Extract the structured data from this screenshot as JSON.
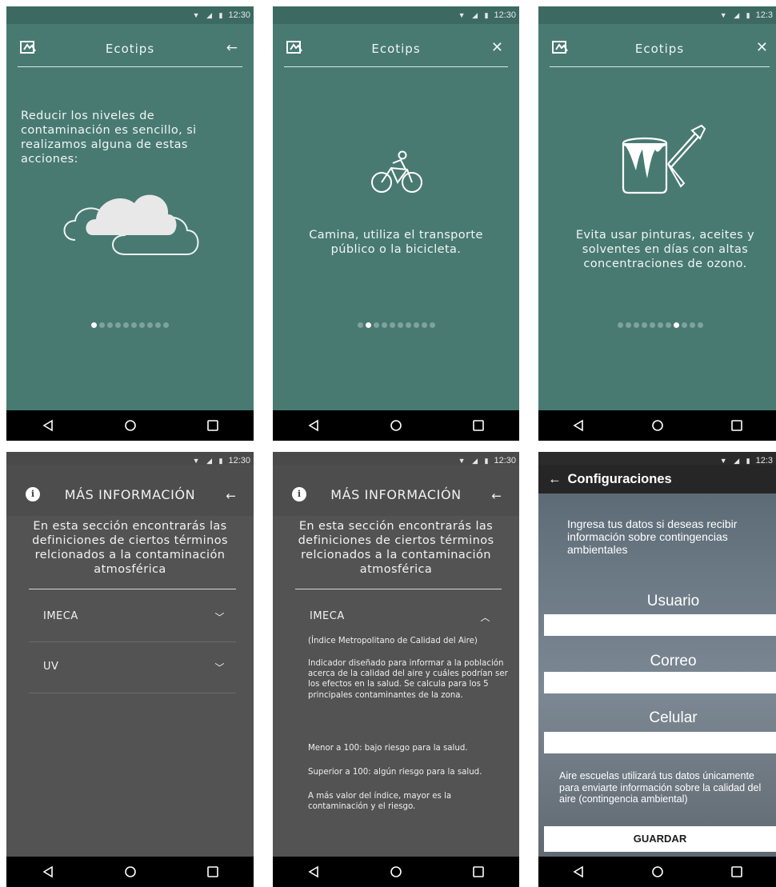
{
  "status": {
    "time": "12:30",
    "time_clipped": "12:3"
  },
  "ecotips": {
    "title": "Ecotips",
    "back_icon": "arrow-left-icon",
    "close_icon": "close-icon",
    "screen1_text": "Reducir los niveles de contaminación es sencillo, si realizamos alguna de estas acciones:",
    "screen2_text": "Camina, utiliza el transporte público o la bicicleta.",
    "screen3_text": "Evita usar pinturas, aceites y solventes en días con altas concentraciones de ozono.",
    "dots_total": 10,
    "active_dot": [
      1,
      2,
      8
    ]
  },
  "info": {
    "title": "MÁS INFORMACIÓN",
    "info_icon": "i",
    "intro": "En esta sección encontrarás las definiciones de ciertos términos relcionados a la contaminación atmosférica",
    "items": [
      "IMECA",
      "UV"
    ],
    "imeca_subtitle": "(Índice Metropolitano de Calidad del Aire)",
    "imeca_desc": "Indicador diseñado para informar a la población acerca de la calidad del aire y cuáles podrían ser los efectos en la salud. Se calcula para los 5 principales contaminantes de la zona.",
    "imeca_low": "Menor a 100: bajo riesgo para la salud.",
    "imeca_high": "Superior a 100: algún riesgo para la salud.",
    "imeca_note": "A más valor del índice, mayor es la contaminación y el riesgo."
  },
  "config": {
    "title": "Configuraciones",
    "back": "←",
    "intro": "Ingresa tus datos si deseas recibir información sobre contingencias ambientales",
    "user_label": "Usuario",
    "email_label": "Correo",
    "phone_label": "Celular",
    "disclaimer": "Aire escuelas utilizará tus datos únicamente para enviarte información sobre la calidad del aire (contingencia ambiental)",
    "save_label": "GUARDAR"
  }
}
